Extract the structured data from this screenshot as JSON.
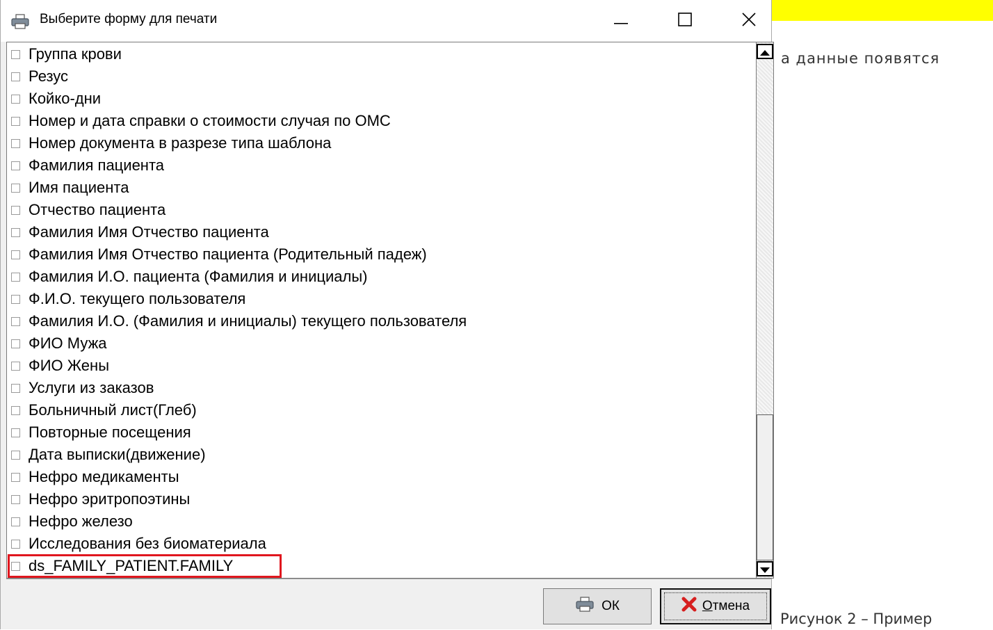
{
  "background": {
    "text_top": "а данные появятся",
    "text_bottom": "Рисунок 2 – Пример"
  },
  "dialog": {
    "title": "Выберите форму для печати",
    "title_icon": "printer-icon",
    "controls": {
      "minimize_icon": "minimize-icon",
      "maximize_icon": "maximize-icon",
      "close_icon": "close-icon"
    },
    "items": [
      {
        "label": "Группа крови",
        "checked": false
      },
      {
        "label": "Резус",
        "checked": false
      },
      {
        "label": "Койко-дни",
        "checked": false
      },
      {
        "label": "Номер и дата справки о стоимости случая по ОМС",
        "checked": false
      },
      {
        "label": "Номер документа в разрезе типа шаблона",
        "checked": false
      },
      {
        "label": "Фамилия пациента",
        "checked": false
      },
      {
        "label": "Имя пациента",
        "checked": false
      },
      {
        "label": "Отчество пациента",
        "checked": false
      },
      {
        "label": "Фамилия Имя Отчество пациента",
        "checked": false
      },
      {
        "label": "Фамилия Имя Отчество пациента (Родительный падеж)",
        "checked": false
      },
      {
        "label": "Фамилия И.О. пациента (Фамилия и инициалы)",
        "checked": false
      },
      {
        "label": "Ф.И.О. текущего пользователя",
        "checked": false
      },
      {
        "label": "Фамилия И.О. (Фамилия и инициалы) текущего пользователя",
        "checked": false
      },
      {
        "label": "ФИО Мужа",
        "checked": false
      },
      {
        "label": "ФИО Жены",
        "checked": false
      },
      {
        "label": "Услуги из заказов",
        "checked": false
      },
      {
        "label": "Больничный лист(Глеб)",
        "checked": false
      },
      {
        "label": "Повторные посещения",
        "checked": false
      },
      {
        "label": "Дата выписки(движение)",
        "checked": false
      },
      {
        "label": "Нефро медикаменты",
        "checked": false
      },
      {
        "label": "Нефро эритропоэтины",
        "checked": false
      },
      {
        "label": "Нефро железо",
        "checked": false
      },
      {
        "label": "Исследования без биоматериала",
        "checked": false
      },
      {
        "label": "ds_FAMILY_PATIENT.FAMILY",
        "checked": false,
        "highlighted": true
      }
    ],
    "buttons": {
      "ok": {
        "label": "ОК",
        "icon": "printer-icon"
      },
      "cancel": {
        "label": "Отмена",
        "icon": "cancel-x-icon"
      }
    },
    "highlight_color": "#e0161e"
  }
}
